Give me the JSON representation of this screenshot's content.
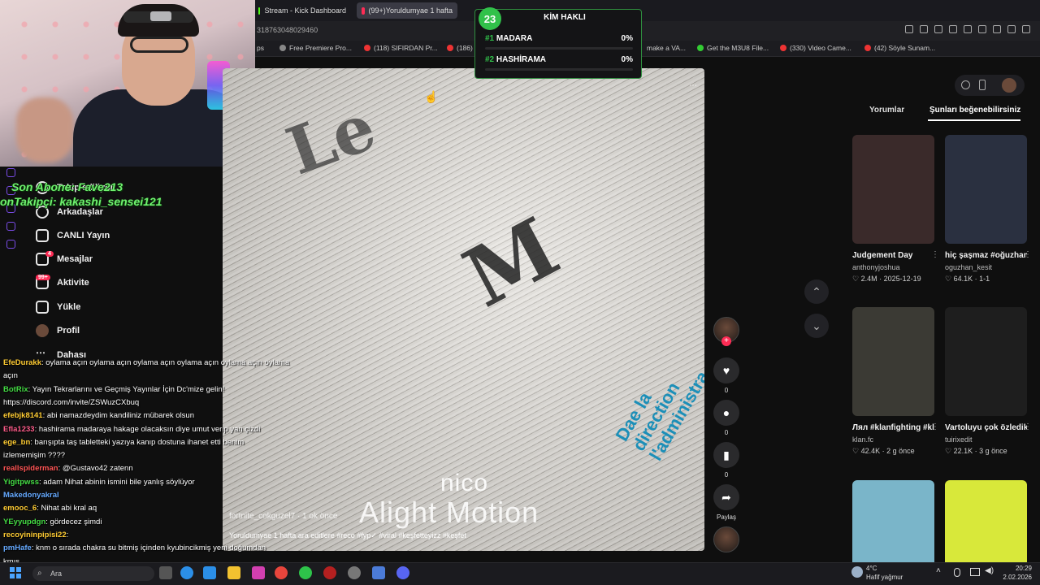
{
  "browser": {
    "tabs": [
      {
        "label": "Stream - Kick Dashboard",
        "color": "#53fc18"
      },
      {
        "label": "(99+)Yoruldumyae 1 hafta",
        "color": "#fe2c55"
      }
    ],
    "url": "318763048029460",
    "bookmarks": [
      "Free Premiere Pro...",
      "(118) SIFIRDAN Pr...",
      "(186)",
      "make a VA...",
      "Get the M3U8 File...",
      "(330) Video Came...",
      "(42) Söyle Sunam..."
    ],
    "bookmark_prefix": "ps"
  },
  "poll": {
    "number": "23",
    "title": "KİM HAKLI",
    "options": [
      {
        "rank": "#1",
        "label": "MADARA",
        "pct": "0%"
      },
      {
        "rank": "#2",
        "label": "HASHİRAMA",
        "pct": "0%"
      }
    ]
  },
  "stream_overlay": {
    "line1": "Son Abone: Fave213",
    "line2": "onTakipçi: kakashi_sensei121"
  },
  "sidebar": {
    "items": [
      {
        "label": "Takip ediliyor",
        "icon": "following-icon"
      },
      {
        "label": "Arkadaşlar",
        "icon": "friends-icon"
      },
      {
        "label": "CANLI Yayın",
        "icon": "live-icon"
      },
      {
        "label": "Mesajlar",
        "icon": "messages-icon",
        "badge": "4"
      },
      {
        "label": "Aktivite",
        "icon": "activity-icon",
        "badge": "99+"
      },
      {
        "label": "Yükle",
        "icon": "upload-icon"
      },
      {
        "label": "Profil",
        "icon": "profile-icon"
      },
      {
        "label": "Dahası",
        "icon": "more-icon"
      }
    ]
  },
  "chat": [
    {
      "user": "EfeDurakk",
      "color": "#ffcc33",
      "text": ": oylama açın oylama açın oylama açın oylama açın oylama açın oylama"
    },
    {
      "user": "",
      "color": "#ffffff",
      "text": "açın"
    },
    {
      "user": "BotRix",
      "color": "#44dd44",
      "text": ": Yayın Tekrarlarını ve Geçmiş Yayınlar İçin Dc'mize gelin!"
    },
    {
      "user": "",
      "color": "#ffffff",
      "text": "https://discord.com/invite/ZSWuzCXbuq"
    },
    {
      "user": "efebjk8141",
      "color": "#ffcc33",
      "text": ": abi namazdeydim kandiliniz mübarek olsun"
    },
    {
      "user": "Efla1233",
      "color": "#ff5c8a",
      "text": ": hashirama madaraya hakage olacaksın diye umut verip yan çizdi"
    },
    {
      "user": "ege_bn",
      "color": "#ffcc33",
      "text": ": barışıpta taş tabletteki yazıya kanıp dostuna ihanet etti benim"
    },
    {
      "user": "",
      "color": "#ffffff",
      "text": "izlememişim ????"
    },
    {
      "user": "reallspiderman",
      "color": "#ff5555",
      "text": ": @Gustavo42 zatenn"
    },
    {
      "user": "Yigitpwss",
      "color": "#44dd44",
      "text": ": adam Nihat abinin ismini bile yanlış söylüyor"
    },
    {
      "user": "Makedonyakral",
      "color": "#66aaff",
      "text": ""
    },
    {
      "user": "emooc_6",
      "color": "#ffcc33",
      "text": ": Nihat abi kral aq"
    },
    {
      "user": "YEyyupdgn",
      "color": "#44dd44",
      "text": ": gördecez şimdi"
    },
    {
      "user": "recoyininpipisi22",
      "color": "#ffcc33",
      "text": ":"
    },
    {
      "user": "pmHafe",
      "color": "#66aaff",
      "text": ": knm o sırada chakra su bitmiş içinden kyubincikmiş yeni doğumdan"
    },
    {
      "user": "",
      "color": "#ffffff",
      "text": "kmış"
    }
  ],
  "video": {
    "watermark_small": "nico",
    "watermark_big": "Alight Motion",
    "author": "fortnite_cokguzel7 · 1 ok önce",
    "description": "Yoruldumyae 1 hafta ara editlere #reco #fyp✓ #viral #keşfetteyizz #keşfet"
  },
  "actions": [
    {
      "name": "like",
      "icon": "♥",
      "count": "0"
    },
    {
      "name": "comment",
      "icon": "●",
      "count": "0"
    },
    {
      "name": "save",
      "icon": "▮",
      "count": "0"
    },
    {
      "name": "share",
      "icon": "➦",
      "count": "Paylaş"
    }
  ],
  "right_panel": {
    "tabs": [
      "Yorumlar",
      "Şunları beğenebilirsiniz"
    ],
    "cards": [
      {
        "title": "Judgement Day",
        "author": "anthonyjoshua",
        "views": "2.4M",
        "date": "2025-12-19",
        "bg": "#3a2a2a"
      },
      {
        "title": "hiç şaşmaz #oğuzhanalpdoğ...",
        "author": "oguzhan_kesit",
        "views": "64.1K",
        "date": "1-1",
        "bg": "#2a3040"
      },
      {
        "title": "Лял #klanfighting #klanfc #спорт ді...",
        "author": "klan.fc",
        "views": "42.4K",
        "date": "2 g önce",
        "bg": "#3b3a34"
      },
      {
        "title": "Vartoluyu çok özledik be #viral...",
        "author": "tuirixedit",
        "views": "22.1K",
        "date": "3 g önce",
        "bg": "#1e1e1e"
      },
      {
        "title": "",
        "author": "",
        "views": "",
        "date": "",
        "bg": "#7ab5c9"
      },
      {
        "title": "",
        "author": "",
        "views": "",
        "date": "",
        "bg": "#d8e83a"
      }
    ]
  },
  "taskbar": {
    "search": "Ara",
    "weather_temp": "4°C",
    "weather_desc": "Hafif yağmur",
    "time": "20:29",
    "date": "2.02.2026"
  }
}
